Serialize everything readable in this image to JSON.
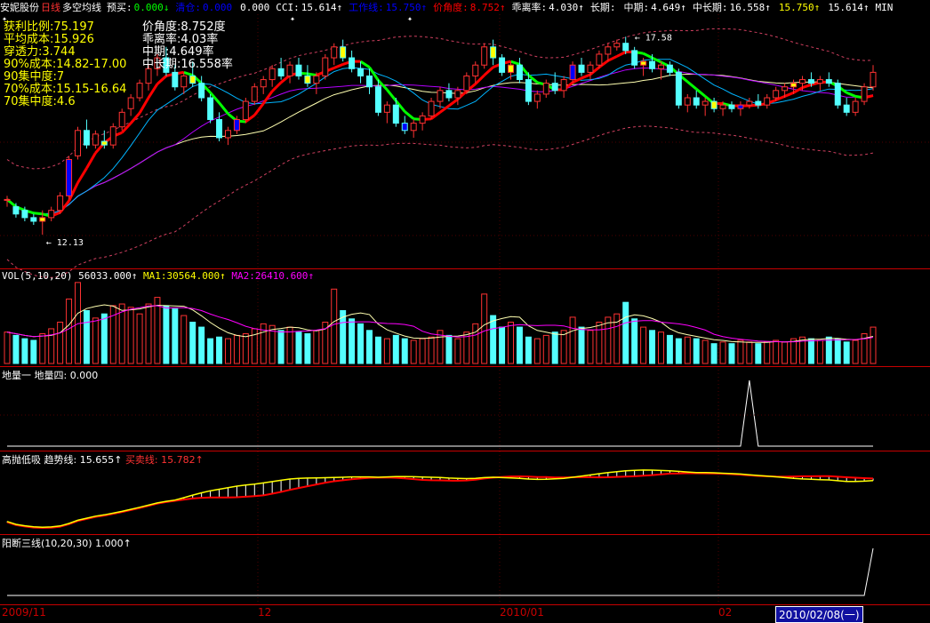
{
  "topbar": {
    "stock": "安妮股份",
    "period": "日线",
    "indicator": "多空均线",
    "items": [
      {
        "label": "预买:",
        "value": "0.000",
        "arrow": "↓",
        "color": "#ffffff",
        "vcolor": "#00ff00"
      },
      {
        "label": "清仓:",
        "value": "0.000",
        "arrow": "",
        "color": "#0000ff",
        "vcolor": "#0000ff"
      },
      {
        "label": "",
        "value": "0.000",
        "arrow": "",
        "color": "#ffffff",
        "vcolor": "#ffffff"
      },
      {
        "label": "CCI:",
        "value": "15.614",
        "arrow": "↑",
        "color": "#ffffff",
        "vcolor": "#ffffff"
      },
      {
        "label": "工作线:",
        "value": "15.750",
        "arrow": "↑",
        "color": "#0000ff",
        "vcolor": "#0000ff"
      },
      {
        "label": "价角度:",
        "value": "8.752",
        "arrow": "↑",
        "color": "#ff0000",
        "vcolor": "#ff0000"
      },
      {
        "label": "乖离率:",
        "value": "4.030",
        "arrow": "↑",
        "color": "#ffffff",
        "vcolor": "#ffffff"
      },
      {
        "label": "长期:",
        "value": "",
        "arrow": "",
        "color": "#ffffff",
        "vcolor": "#ffffff"
      },
      {
        "label": "中期:",
        "value": "4.649",
        "arrow": "↑",
        "color": "#ffffff",
        "vcolor": "#ffffff"
      },
      {
        "label": "中长期:",
        "value": "16.558",
        "arrow": "↑",
        "color": "#ffffff",
        "vcolor": "#ffffff"
      },
      {
        "label": "",
        "value": "15.750",
        "arrow": "↑",
        "color": "#ffff00",
        "vcolor": "#ffff00"
      },
      {
        "label": "",
        "value": "15.614",
        "arrow": "↑",
        "color": "#ffffff",
        "vcolor": "#ffffff"
      },
      {
        "label": "MIN",
        "value": "",
        "arrow": "",
        "color": "#ffffff",
        "vcolor": "#ffffff"
      }
    ]
  },
  "info_left": [
    "获利比例:75.197",
    "平均成本:15.926",
    "穿透力:3.744",
    "90%成本:14.82-17.00",
    "90集中度:7",
    "70%成本:15.15-16.64",
    "70集中度:4.6"
  ],
  "info_right": [
    "价角度:8.752度",
    "乖离率:4.03率",
    "中期:4.649率",
    "中长期:16.558率"
  ],
  "price_labels": {
    "high": "17.58",
    "low": "12.13"
  },
  "panels": {
    "vol": {
      "name": "VOL(5,10,20)",
      "v1": "56033.000",
      "ma1_label": "MA1:",
      "ma1": "30564.000",
      "ma2_label": "MA2:",
      "ma2": "26410.600",
      "a1": "↑",
      "a2": "↑",
      "a3": "↑"
    },
    "dl": {
      "name": "地量一",
      "name2": "地量四:",
      "value": "0.000"
    },
    "gd": {
      "name": "高抛低吸",
      "trend_label": "趋势线:",
      "trend": "15.655",
      "bs_label": "买卖线:",
      "bs": "15.782",
      "a1": "↑",
      "a2": "↑"
    },
    "yd": {
      "name": "阳断三线(10,20,30)",
      "value": "1.000",
      "a1": "↑"
    }
  },
  "xaxis": {
    "labels": [
      "2009/11",
      "12",
      "2010/01",
      "02"
    ],
    "current": "2010/02/08(一)"
  },
  "colors": {
    "up": "#ff3232",
    "down": "#54ffff",
    "ma_red": "#ff0000",
    "ma_green": "#00ff00",
    "blue": "#0000ff",
    "yellow": "#ffff00",
    "purple": "#b400ff",
    "cyan": "#00b4ff",
    "grid": "#c80000"
  },
  "chart_data": {
    "type": "candlestick",
    "candles": [
      [
        13.1,
        13.2,
        12.9,
        13.1
      ],
      [
        12.9,
        13.0,
        12.6,
        12.7
      ],
      [
        12.8,
        12.9,
        12.5,
        12.6
      ],
      [
        12.6,
        12.7,
        12.4,
        12.5
      ],
      [
        12.5,
        12.8,
        12.13,
        12.6
      ],
      [
        12.6,
        12.9,
        12.5,
        12.8
      ],
      [
        12.8,
        13.3,
        12.7,
        13.2
      ],
      [
        13.2,
        14.3,
        13.1,
        14.2
      ],
      [
        14.3,
        15.1,
        14.2,
        15.0
      ],
      [
        15.0,
        15.3,
        14.5,
        14.6
      ],
      [
        14.6,
        15.0,
        14.5,
        14.9
      ],
      [
        14.7,
        15.0,
        14.5,
        14.6
      ],
      [
        14.6,
        15.2,
        14.5,
        15.1
      ],
      [
        15.1,
        15.6,
        15.0,
        15.5
      ],
      [
        15.6,
        16.0,
        15.4,
        15.9
      ],
      [
        15.9,
        16.4,
        15.8,
        16.3
      ],
      [
        16.3,
        16.8,
        16.1,
        16.7
      ],
      [
        16.7,
        17.1,
        16.5,
        17.0
      ],
      [
        17.0,
        17.3,
        16.5,
        16.6
      ],
      [
        16.6,
        16.8,
        16.1,
        16.2
      ],
      [
        16.2,
        16.6,
        16.0,
        16.5
      ],
      [
        16.5,
        16.9,
        16.2,
        16.3
      ],
      [
        16.3,
        16.5,
        15.8,
        15.9
      ],
      [
        15.9,
        16.0,
        15.2,
        15.3
      ],
      [
        15.3,
        15.5,
        14.7,
        14.8
      ],
      [
        14.8,
        15.1,
        14.6,
        15.0
      ],
      [
        15.0,
        15.4,
        14.9,
        15.3
      ],
      [
        15.3,
        15.9,
        15.2,
        15.8
      ],
      [
        15.8,
        16.3,
        15.7,
        16.2
      ],
      [
        16.2,
        16.5,
        16.0,
        16.4
      ],
      [
        16.4,
        16.8,
        16.2,
        16.7
      ],
      [
        16.7,
        17.0,
        16.4,
        16.5
      ],
      [
        16.5,
        16.9,
        16.3,
        16.8
      ],
      [
        16.8,
        17.0,
        16.4,
        16.5
      ],
      [
        16.5,
        16.8,
        16.2,
        16.3
      ],
      [
        16.3,
        16.6,
        16.0,
        16.5
      ],
      [
        16.5,
        17.1,
        16.4,
        17.0
      ],
      [
        17.0,
        17.4,
        16.8,
        17.3
      ],
      [
        17.3,
        17.5,
        16.9,
        17.0
      ],
      [
        17.0,
        17.2,
        16.6,
        16.7
      ],
      [
        16.7,
        16.9,
        16.3,
        16.5
      ],
      [
        16.5,
        16.7,
        16.0,
        16.2
      ],
      [
        16.2,
        16.4,
        15.4,
        15.5
      ],
      [
        15.5,
        15.8,
        15.2,
        15.7
      ],
      [
        15.7,
        15.9,
        15.1,
        15.2
      ],
      [
        15.2,
        15.4,
        14.9,
        15.0
      ],
      [
        15.0,
        15.3,
        14.8,
        15.2
      ],
      [
        15.2,
        15.5,
        15.0,
        15.4
      ],
      [
        15.4,
        15.9,
        15.3,
        15.8
      ],
      [
        15.8,
        16.2,
        15.6,
        16.1
      ],
      [
        16.1,
        16.3,
        15.8,
        15.9
      ],
      [
        15.9,
        16.2,
        15.7,
        16.1
      ],
      [
        16.1,
        16.6,
        16.0,
        16.5
      ],
      [
        16.5,
        16.9,
        16.3,
        16.8
      ],
      [
        16.8,
        17.4,
        16.7,
        17.3
      ],
      [
        17.3,
        17.5,
        16.8,
        17.0
      ],
      [
        17.0,
        17.1,
        16.5,
        16.6
      ],
      [
        16.6,
        16.9,
        16.4,
        16.8
      ],
      [
        16.8,
        17.0,
        16.3,
        16.4
      ],
      [
        16.4,
        16.6,
        15.7,
        15.8
      ],
      [
        15.8,
        16.1,
        15.6,
        16.0
      ],
      [
        16.0,
        16.4,
        15.9,
        16.3
      ],
      [
        16.3,
        16.6,
        16.0,
        16.1
      ],
      [
        16.1,
        16.5,
        15.9,
        16.4
      ],
      [
        16.4,
        16.9,
        16.3,
        16.8
      ],
      [
        16.8,
        17.0,
        16.5,
        16.6
      ],
      [
        16.6,
        16.9,
        16.4,
        16.8
      ],
      [
        16.8,
        17.2,
        16.7,
        17.1
      ],
      [
        17.1,
        17.4,
        16.9,
        17.3
      ],
      [
        17.3,
        17.5,
        17.2,
        17.4
      ],
      [
        17.4,
        17.58,
        17.1,
        17.2
      ],
      [
        17.2,
        17.3,
        16.7,
        16.8
      ],
      [
        16.8,
        17.0,
        16.5,
        16.9
      ],
      [
        16.9,
        17.1,
        16.6,
        16.7
      ],
      [
        16.7,
        16.9,
        16.4,
        16.8
      ],
      [
        16.8,
        16.9,
        16.5,
        16.6
      ],
      [
        16.6,
        16.7,
        15.6,
        15.7
      ],
      [
        15.7,
        16.0,
        15.5,
        15.9
      ],
      [
        15.9,
        16.1,
        15.6,
        15.7
      ],
      [
        15.7,
        15.9,
        15.4,
        15.8
      ],
      [
        15.8,
        15.9,
        15.5,
        15.6
      ],
      [
        15.6,
        15.8,
        15.4,
        15.7
      ],
      [
        15.7,
        15.8,
        15.5,
        15.6
      ],
      [
        15.6,
        15.8,
        15.4,
        15.7
      ],
      [
        15.7,
        15.9,
        15.6,
        15.8
      ],
      [
        15.8,
        16.0,
        15.6,
        15.7
      ],
      [
        15.7,
        16.0,
        15.6,
        15.9
      ],
      [
        15.9,
        16.2,
        15.8,
        16.1
      ],
      [
        16.1,
        16.3,
        15.9,
        16.2
      ],
      [
        16.2,
        16.4,
        16.0,
        16.3
      ],
      [
        16.3,
        16.5,
        16.1,
        16.4
      ],
      [
        16.4,
        16.6,
        16.2,
        16.3
      ],
      [
        16.3,
        16.5,
        16.1,
        16.4
      ],
      [
        16.4,
        16.6,
        16.2,
        16.3
      ],
      [
        16.3,
        16.4,
        15.6,
        15.7
      ],
      [
        15.7,
        15.9,
        15.4,
        15.5
      ],
      [
        15.5,
        15.9,
        15.4,
        15.8
      ],
      [
        15.8,
        16.3,
        15.7,
        16.2
      ],
      [
        16.2,
        16.8,
        16.1,
        16.6
      ]
    ],
    "volumes": [
      38,
      34,
      30,
      28,
      36,
      42,
      50,
      78,
      98,
      64,
      55,
      60,
      70,
      72,
      68,
      60,
      72,
      80,
      70,
      66,
      58,
      50,
      44,
      30,
      32,
      30,
      34,
      36,
      42,
      48,
      46,
      40,
      44,
      38,
      36,
      40,
      50,
      90,
      64,
      54,
      48,
      40,
      32,
      30,
      34,
      30,
      28,
      30,
      32,
      40,
      34,
      30,
      38,
      48,
      84,
      58,
      44,
      50,
      44,
      32,
      30,
      34,
      38,
      40,
      56,
      44,
      40,
      50,
      56,
      60,
      74,
      54,
      44,
      40,
      38,
      34,
      30,
      32,
      30,
      28,
      24,
      26,
      24,
      28,
      26,
      24,
      26,
      28,
      26,
      30,
      32,
      30,
      28,
      32,
      30,
      26,
      28,
      36,
      44
    ],
    "yrange": [
      11.3,
      18.2
    ]
  }
}
